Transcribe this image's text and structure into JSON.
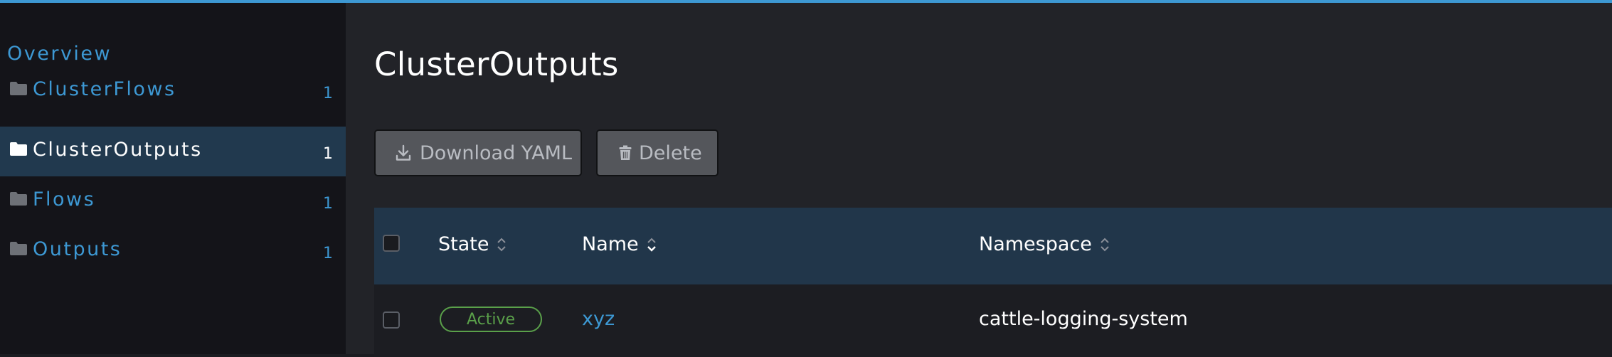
{
  "sidebar": {
    "overview_label": "Overview",
    "items": [
      {
        "label": "ClusterFlows",
        "count": "1",
        "active": false
      },
      {
        "label": "ClusterOutputs",
        "count": "1",
        "active": true
      },
      {
        "label": "Flows",
        "count": "1",
        "active": false
      },
      {
        "label": "Outputs",
        "count": "1",
        "active": false
      }
    ]
  },
  "main": {
    "title": "ClusterOutputs",
    "actions": {
      "download_label": "Download YAML",
      "delete_label": "Delete"
    },
    "table": {
      "columns": [
        "State",
        "Name",
        "Namespace"
      ],
      "rows": [
        {
          "state": "Active",
          "name": "xyz",
          "namespace": "cattle-logging-system"
        }
      ]
    }
  },
  "colors": {
    "accent": "#3d98d3",
    "active_nav_bg": "#21394e",
    "table_header_bg": "#21364a",
    "status_active": "#5aa04a"
  },
  "icons": [
    "folder-icon",
    "download-icon",
    "trash-icon",
    "sort-icon"
  ]
}
